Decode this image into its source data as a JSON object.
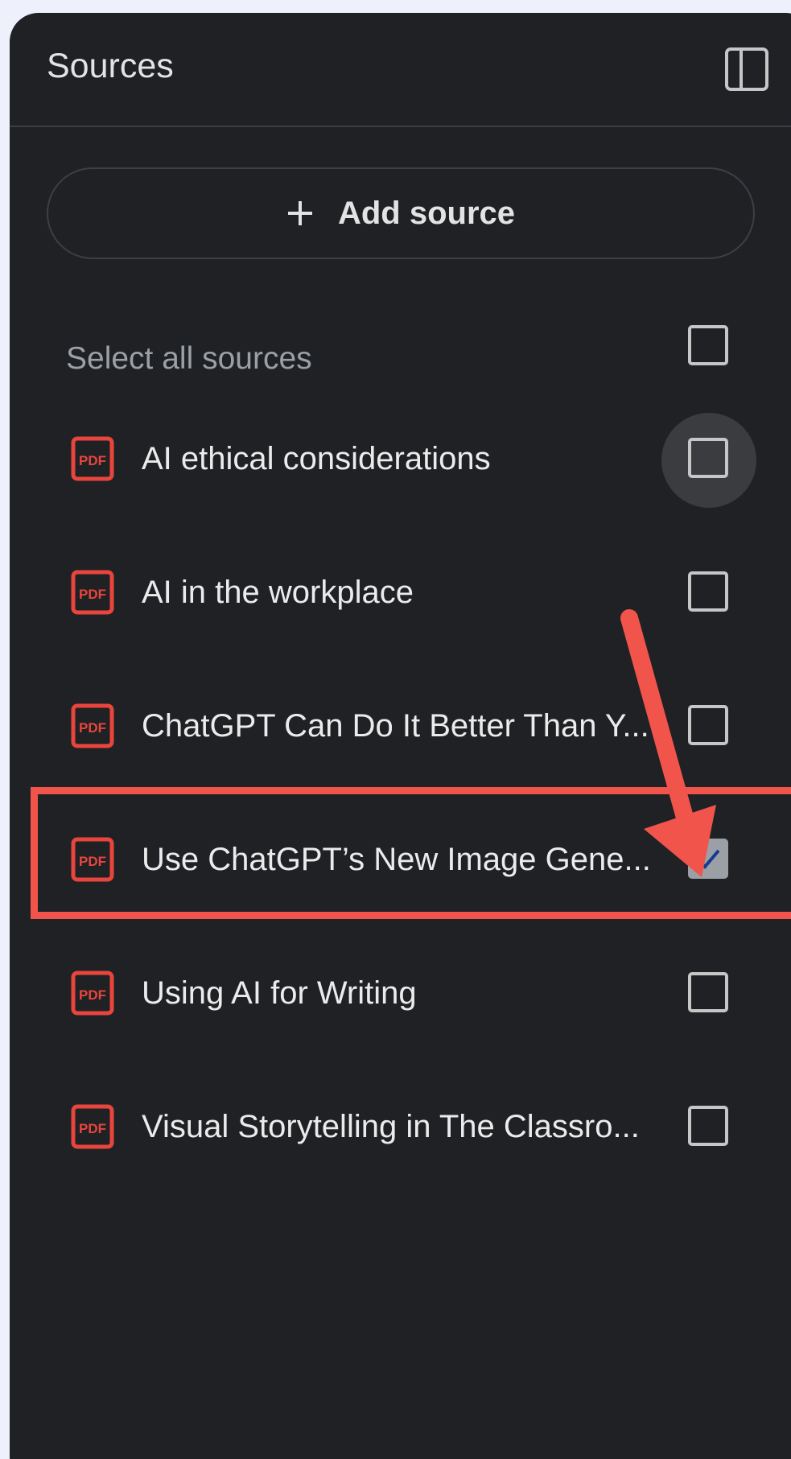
{
  "header": {
    "title": "Sources",
    "toggle_icon": "side-panel-icon"
  },
  "add_source": {
    "icon": "plus-icon",
    "label": "Add source"
  },
  "select_all": {
    "label": "Select all sources",
    "checked": false
  },
  "sources": [
    {
      "label": "AI ethical considerations",
      "icon": "pdf-icon",
      "checked": false
    },
    {
      "label": "AI in the workplace",
      "icon": "pdf-icon",
      "checked": false
    },
    {
      "label": "ChatGPT Can Do It Better Than Y...",
      "icon": "pdf-icon",
      "checked": false
    },
    {
      "label": "Use ChatGPT’s New Image Gene...",
      "icon": "pdf-icon",
      "checked": true
    },
    {
      "label": "Using AI for Writing",
      "icon": "pdf-icon",
      "checked": false
    },
    {
      "label": "Visual Storytelling in The Classro...",
      "icon": "pdf-icon",
      "checked": false
    }
  ],
  "annotation": {
    "color": "#f0544a",
    "highlighted_item": "Use ChatGPT’s New Image Gene..."
  },
  "colors": {
    "panel_bg": "#1f2125",
    "page_bg": "#eef0fb",
    "pdf_red": "#e8453c",
    "check_fill": "#9aa0a6",
    "check_mark": "#1a3a8f"
  }
}
